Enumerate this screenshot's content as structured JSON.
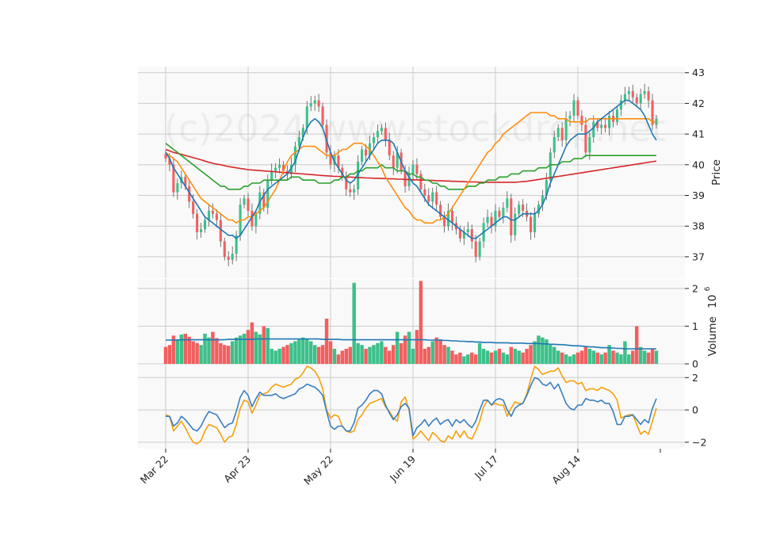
{
  "watermark": "(c)2024 www.stockdrop.net",
  "colors": {
    "up": "#3cc08a",
    "down": "#f25f5f",
    "ma_short": "#1f77b4",
    "ma_mid": "#ff8c0f",
    "ma_long": "#2ca02c",
    "ma_xlong": "#d62728",
    "vol_ma": "#1f77b4",
    "osc_a": "#3a7fc0",
    "osc_b": "#f5a10a",
    "grid": "#cccccc",
    "panel_bg": "#f9f9f9"
  },
  "chart_data": {
    "type": "candlestick",
    "x_ticks": [
      "Mar 22",
      "Apr 23",
      "May 22",
      "Jun 19",
      "Jul 17",
      "Aug 14"
    ],
    "tick_index": [
      0,
      21,
      42,
      63,
      84,
      105
    ],
    "n_days": 126,
    "price_panel": {
      "ylabel": "Price",
      "ylim": [
        36.3,
        43.2
      ],
      "yticks": [
        37,
        38,
        39,
        40,
        41,
        42,
        43
      ],
      "close": [
        40.2,
        40.0,
        39.1,
        39.4,
        39.6,
        39.3,
        38.8,
        38.4,
        37.8,
        37.9,
        38.2,
        38.5,
        38.4,
        38.2,
        37.5,
        37.0,
        36.9,
        37.1,
        37.7,
        38.7,
        38.9,
        38.5,
        38.0,
        38.4,
        39.1,
        38.6,
        39.5,
        39.8,
        39.9,
        40.0,
        39.8,
        39.7,
        40.0,
        40.6,
        40.9,
        41.2,
        41.9,
        42.0,
        42.1,
        41.9,
        41.3,
        40.4,
        40.0,
        40.3,
        39.9,
        39.6,
        39.2,
        39.1,
        39.2,
        40.1,
        40.5,
        40.3,
        40.7,
        40.9,
        41.1,
        41.2,
        40.8,
        40.3,
        39.9,
        40.4,
        39.8,
        39.3,
        39.7,
        40.0,
        39.7,
        39.2,
        39.0,
        38.8,
        39.1,
        38.7,
        38.3,
        38.0,
        38.5,
        38.1,
        37.9,
        37.6,
        37.8,
        37.9,
        37.5,
        37.0,
        37.5,
        38.1,
        38.3,
        38.0,
        38.5,
        38.3,
        38.6,
        38.9,
        37.7,
        38.4,
        38.7,
        38.5,
        38.3,
        37.8,
        38.4,
        38.7,
        39.0,
        39.5,
        40.4,
        40.9,
        41.2,
        40.8,
        41.5,
        41.6,
        42.1,
        41.6,
        41.3,
        40.4,
        40.9,
        41.4,
        41.2,
        41.3,
        41.2,
        41.6,
        41.4,
        41.8,
        42.1,
        42.3,
        42.4,
        42.2,
        42.0,
        42.3,
        42.4,
        42.1,
        41.3,
        41.5
      ],
      "ma_short": [
        40.4,
        40.2,
        39.9,
        39.7,
        39.5,
        39.3,
        39.1,
        38.9,
        38.7,
        38.5,
        38.3,
        38.2,
        38.1,
        38.0,
        37.9,
        37.8,
        37.7,
        37.7,
        37.6,
        37.7,
        37.9,
        38.1,
        38.3,
        38.5,
        38.8,
        39.0,
        39.2,
        39.3,
        39.4,
        39.5,
        39.6,
        39.7,
        39.9,
        40.1,
        40.5,
        40.9,
        41.2,
        41.4,
        41.5,
        41.4,
        41.2,
        40.8,
        40.4,
        40.1,
        39.9,
        39.7,
        39.5,
        39.4,
        39.5,
        39.7,
        39.9,
        40.1,
        40.3,
        40.5,
        40.7,
        40.8,
        40.8,
        40.8,
        40.7,
        40.4,
        40.1,
        39.8,
        39.6,
        39.4,
        39.3,
        39.1,
        38.9,
        38.7,
        38.6,
        38.5,
        38.4,
        38.3,
        38.2,
        38.1,
        38.0,
        37.9,
        37.8,
        37.7,
        37.6,
        37.6,
        37.7,
        37.8,
        37.9,
        38.0,
        38.1,
        38.2,
        38.3,
        38.3,
        38.2,
        38.2,
        38.3,
        38.4,
        38.4,
        38.4,
        38.4,
        38.5,
        38.7,
        39.0,
        39.4,
        39.7,
        40.0,
        40.3,
        40.6,
        40.8,
        40.9,
        41.0,
        41.0,
        41.0,
        41.1,
        41.2,
        41.4,
        41.5,
        41.6,
        41.7,
        41.8,
        41.9,
        42.0,
        42.1,
        42.1,
        42.0,
        41.9,
        41.8,
        41.6,
        41.3,
        41.0,
        40.8
      ],
      "ma_mid": [
        40.4,
        40.3,
        40.2,
        40.1,
        39.9,
        39.7,
        39.5,
        39.3,
        39.1,
        38.9,
        38.8,
        38.7,
        38.6,
        38.5,
        38.4,
        38.3,
        38.2,
        38.2,
        38.1,
        38.2,
        38.2,
        38.3,
        38.3,
        38.4,
        38.5,
        38.6,
        38.8,
        39.0,
        39.2,
        39.5,
        39.8,
        40.1,
        40.3,
        40.4,
        40.5,
        40.6,
        40.6,
        40.6,
        40.6,
        40.5,
        40.4,
        40.3,
        40.3,
        40.3,
        40.4,
        40.5,
        40.5,
        40.6,
        40.7,
        40.7,
        40.7,
        40.6,
        40.5,
        40.3,
        40.1,
        39.9,
        39.6,
        39.4,
        39.2,
        39.0,
        38.8,
        38.6,
        38.5,
        38.3,
        38.2,
        38.2,
        38.1,
        38.1,
        38.1,
        38.2,
        38.2,
        38.3,
        38.4,
        38.6,
        38.8,
        39.0,
        39.2,
        39.4,
        39.6,
        39.8,
        40.0,
        40.2,
        40.4,
        40.5,
        40.7,
        40.8,
        41.0,
        41.1,
        41.2,
        41.3,
        41.4,
        41.5,
        41.6,
        41.7,
        41.7,
        41.7,
        41.7,
        41.7,
        41.6,
        41.6,
        41.5,
        41.5,
        41.5,
        41.4,
        41.4,
        41.4,
        41.4,
        41.4,
        41.5,
        41.5,
        41.5,
        41.5,
        41.5,
        41.5,
        41.5,
        41.5,
        41.5,
        41.5,
        41.5,
        41.5,
        41.5,
        41.5,
        41.5,
        41.5,
        41.4,
        41.4
      ],
      "ma_long": [
        40.7,
        40.6,
        40.5,
        40.4,
        40.3,
        40.2,
        40.1,
        40.0,
        39.9,
        39.8,
        39.7,
        39.6,
        39.5,
        39.4,
        39.3,
        39.3,
        39.2,
        39.2,
        39.2,
        39.2,
        39.3,
        39.3,
        39.4,
        39.4,
        39.4,
        39.5,
        39.5,
        39.5,
        39.5,
        39.5,
        39.5,
        39.5,
        39.6,
        39.6,
        39.6,
        39.5,
        39.5,
        39.5,
        39.5,
        39.4,
        39.4,
        39.4,
        39.4,
        39.5,
        39.5,
        39.6,
        39.6,
        39.7,
        39.7,
        39.8,
        39.8,
        39.9,
        39.9,
        39.9,
        39.9,
        40.0,
        39.9,
        39.9,
        39.9,
        39.8,
        39.8,
        39.8,
        39.7,
        39.7,
        39.6,
        39.6,
        39.5,
        39.5,
        39.4,
        39.4,
        39.3,
        39.3,
        39.2,
        39.2,
        39.2,
        39.2,
        39.2,
        39.3,
        39.3,
        39.3,
        39.4,
        39.4,
        39.5,
        39.5,
        39.5,
        39.6,
        39.6,
        39.6,
        39.7,
        39.7,
        39.7,
        39.8,
        39.8,
        39.8,
        39.8,
        39.9,
        39.9,
        39.9,
        40.0,
        40.0,
        40.0,
        40.1,
        40.1,
        40.1,
        40.2,
        40.2,
        40.2,
        40.3,
        40.3,
        40.3,
        40.3,
        40.3,
        40.3,
        40.3,
        40.3,
        40.3,
        40.3,
        40.3,
        40.3,
        40.3,
        40.3,
        40.3,
        40.3,
        40.3,
        40.3,
        40.3
      ],
      "ma_xlong": [
        40.5,
        40.45,
        40.4,
        40.37,
        40.34,
        40.3,
        40.27,
        40.23,
        40.2,
        40.16,
        40.12,
        40.08,
        40.05,
        40.02,
        40.0,
        39.97,
        39.94,
        39.92,
        39.9,
        39.88,
        39.86,
        39.84,
        39.83,
        39.82,
        39.81,
        39.8,
        39.79,
        39.78,
        39.77,
        39.76,
        39.75,
        39.74,
        39.73,
        39.72,
        39.71,
        39.7,
        39.69,
        39.68,
        39.67,
        39.66,
        39.65,
        39.64,
        39.63,
        39.62,
        39.62,
        39.61,
        39.6,
        39.6,
        39.59,
        39.58,
        39.58,
        39.57,
        39.57,
        39.56,
        39.56,
        39.55,
        39.55,
        39.54,
        39.54,
        39.53,
        39.53,
        39.52,
        39.52,
        39.51,
        39.51,
        39.5,
        39.5,
        39.49,
        39.49,
        39.48,
        39.48,
        39.47,
        39.47,
        39.46,
        39.46,
        39.45,
        39.45,
        39.44,
        39.44,
        39.44,
        39.43,
        39.43,
        39.43,
        39.43,
        39.43,
        39.43,
        39.43,
        39.43,
        39.43,
        39.43,
        39.44,
        39.45,
        39.46,
        39.48,
        39.5,
        39.52,
        39.54,
        39.56,
        39.58,
        39.6,
        39.62,
        39.64,
        39.66,
        39.68,
        39.7,
        39.72,
        39.74,
        39.76,
        39.78,
        39.8,
        39.82,
        39.84,
        39.86,
        39.88,
        39.9,
        39.92,
        39.94,
        39.96,
        39.98,
        40.0,
        40.02,
        40.04,
        40.06,
        40.08,
        40.1,
        40.12
      ]
    },
    "volume_panel": {
      "ylabel": "Volume",
      "exponent": "6",
      "ylim": [
        0,
        2.25
      ],
      "yticks": [
        0,
        1,
        2
      ],
      "values": [
        0.45,
        0.5,
        0.75,
        0.65,
        0.78,
        0.8,
        0.72,
        0.6,
        0.55,
        0.5,
        0.8,
        0.7,
        0.85,
        0.68,
        0.55,
        0.5,
        0.48,
        0.6,
        0.7,
        0.75,
        0.8,
        0.9,
        1.1,
        0.85,
        0.78,
        1.0,
        0.95,
        0.4,
        0.35,
        0.4,
        0.45,
        0.5,
        0.55,
        0.6,
        0.65,
        0.7,
        0.65,
        0.6,
        0.5,
        0.45,
        0.5,
        1.2,
        0.6,
        0.4,
        0.25,
        0.35,
        0.4,
        0.45,
        2.15,
        0.55,
        0.5,
        0.4,
        0.45,
        0.5,
        0.55,
        0.6,
        0.45,
        0.35,
        0.5,
        0.85,
        0.55,
        0.75,
        0.85,
        0.4,
        0.9,
        2.2,
        0.4,
        0.45,
        0.6,
        0.7,
        0.65,
        0.5,
        0.45,
        0.35,
        0.25,
        0.3,
        0.2,
        0.25,
        0.3,
        0.25,
        0.55,
        0.4,
        0.35,
        0.3,
        0.35,
        0.4,
        0.3,
        0.25,
        0.45,
        0.4,
        0.35,
        0.3,
        0.4,
        0.5,
        0.6,
        0.75,
        0.7,
        0.65,
        0.5,
        0.45,
        0.35,
        0.3,
        0.25,
        0.2,
        0.25,
        0.3,
        0.35,
        0.45,
        0.4,
        0.35,
        0.3,
        0.25,
        0.3,
        0.5,
        0.35,
        0.3,
        0.25,
        0.6,
        0.25,
        0.35,
        1.0,
        0.45,
        0.35,
        0.3,
        0.4,
        0.35
      ],
      "ma": [
        0.63,
        0.63,
        0.63,
        0.63,
        0.64,
        0.64,
        0.64,
        0.64,
        0.64,
        0.64,
        0.64,
        0.64,
        0.64,
        0.64,
        0.64,
        0.64,
        0.65,
        0.65,
        0.65,
        0.65,
        0.65,
        0.65,
        0.65,
        0.66,
        0.66,
        0.66,
        0.66,
        0.66,
        0.66,
        0.66,
        0.66,
        0.66,
        0.66,
        0.66,
        0.66,
        0.66,
        0.66,
        0.66,
        0.66,
        0.66,
        0.65,
        0.65,
        0.65,
        0.65,
        0.65,
        0.64,
        0.64,
        0.64,
        0.64,
        0.64,
        0.64,
        0.64,
        0.64,
        0.64,
        0.64,
        0.64,
        0.64,
        0.64,
        0.64,
        0.64,
        0.64,
        0.64,
        0.64,
        0.64,
        0.64,
        0.64,
        0.64,
        0.63,
        0.63,
        0.63,
        0.63,
        0.62,
        0.62,
        0.61,
        0.61,
        0.6,
        0.6,
        0.59,
        0.59,
        0.58,
        0.58,
        0.57,
        0.57,
        0.57,
        0.56,
        0.56,
        0.56,
        0.56,
        0.55,
        0.55,
        0.55,
        0.55,
        0.54,
        0.54,
        0.54,
        0.54,
        0.53,
        0.53,
        0.52,
        0.52,
        0.51,
        0.51,
        0.5,
        0.49,
        0.48,
        0.48,
        0.47,
        0.46,
        0.45,
        0.45,
        0.44,
        0.43,
        0.43,
        0.42,
        0.42,
        0.41,
        0.41,
        0.4,
        0.4,
        0.4,
        0.4,
        0.4,
        0.4,
        0.4,
        0.4,
        0.4
      ]
    },
    "oscillator_panel": {
      "ylim": [
        -2.4,
        2.8
      ],
      "yticks": [
        -2,
        0,
        2
      ],
      "series_a": [
        -0.4,
        -0.4,
        -1.0,
        -0.8,
        -0.4,
        -0.6,
        -0.9,
        -1.2,
        -1.3,
        -1.0,
        -0.5,
        -0.1,
        -0.2,
        -0.3,
        -0.7,
        -1.1,
        -0.9,
        -0.8,
        -0.1,
        0.8,
        1.2,
        0.9,
        0.2,
        0.7,
        1.1,
        0.9,
        0.9,
        0.9,
        1.0,
        0.8,
        0.7,
        0.8,
        0.9,
        1.0,
        1.3,
        1.4,
        1.6,
        1.5,
        1.4,
        1.2,
        0.9,
        -0.1,
        -1.0,
        -1.2,
        -1.0,
        -1.0,
        -1.3,
        -1.3,
        -0.8,
        0.1,
        0.3,
        0.6,
        1.0,
        1.2,
        1.2,
        1.0,
        0.3,
        -0.2,
        -0.6,
        -0.3,
        0.2,
        0.4,
        0.1,
        -1.6,
        -1.1,
        -0.9,
        -0.6,
        -1.0,
        -0.7,
        -0.5,
        -0.9,
        -0.7,
        -0.6,
        -1.0,
        -0.6,
        -0.8,
        -0.6,
        -0.9,
        -1.1,
        -0.7,
        0.0,
        0.6,
        0.6,
        0.3,
        0.6,
        0.7,
        0.6,
        0.0,
        -0.4,
        0.1,
        0.3,
        0.4,
        0.9,
        1.5,
        2.0,
        1.9,
        1.6,
        1.5,
        1.7,
        1.3,
        1.6,
        1.0,
        0.4,
        0.1,
        0.0,
        0.3,
        0.3,
        0.7,
        0.6,
        0.6,
        0.5,
        0.6,
        0.4,
        0.4,
        -0.1,
        -0.9,
        -0.9,
        -0.4,
        -0.4,
        -0.3,
        -0.6,
        -0.9,
        -0.6,
        -0.8,
        0.1,
        0.7
      ],
      "series_b": [
        -0.3,
        -0.4,
        -1.3,
        -1.0,
        -0.7,
        -1.1,
        -1.6,
        -2.0,
        -2.1,
        -1.9,
        -1.3,
        -0.9,
        -1.0,
        -1.1,
        -1.5,
        -2.0,
        -1.7,
        -1.6,
        -0.9,
        0.1,
        0.6,
        0.5,
        -0.2,
        0.3,
        0.9,
        1.0,
        1.1,
        1.4,
        1.6,
        1.5,
        1.4,
        1.5,
        1.6,
        1.9,
        2.0,
        2.3,
        2.7,
        2.6,
        2.4,
        2.0,
        1.3,
        0.0,
        -0.5,
        -0.3,
        -0.4,
        -1.0,
        -1.3,
        -1.4,
        -1.3,
        -0.6,
        -0.3,
        0.1,
        0.4,
        0.5,
        0.6,
        0.7,
        0.2,
        -0.1,
        -0.5,
        -0.7,
        0.5,
        0.8,
        0.0,
        -1.8,
        -1.6,
        -1.3,
        -1.6,
        -1.9,
        -1.4,
        -1.6,
        -1.9,
        -2.0,
        -1.6,
        -1.8,
        -1.3,
        -1.7,
        -1.3,
        -1.7,
        -1.8,
        -1.3,
        -0.7,
        0.2,
        0.6,
        0.3,
        0.4,
        0.3,
        0.3,
        -0.4,
        0.1,
        0.5,
        0.4,
        0.4,
        1.0,
        1.9,
        2.7,
        2.5,
        2.2,
        2.3,
        2.4,
        2.4,
        2.6,
        2.1,
        1.7,
        1.8,
        1.8,
        1.6,
        1.7,
        1.2,
        1.3,
        1.3,
        1.2,
        1.4,
        1.3,
        1.2,
        1.0,
        0.6,
        -0.5,
        -0.4,
        -0.3,
        -0.3,
        -0.9,
        -1.5,
        -1.3,
        -1.5,
        -0.7,
        0.1
      ]
    }
  }
}
